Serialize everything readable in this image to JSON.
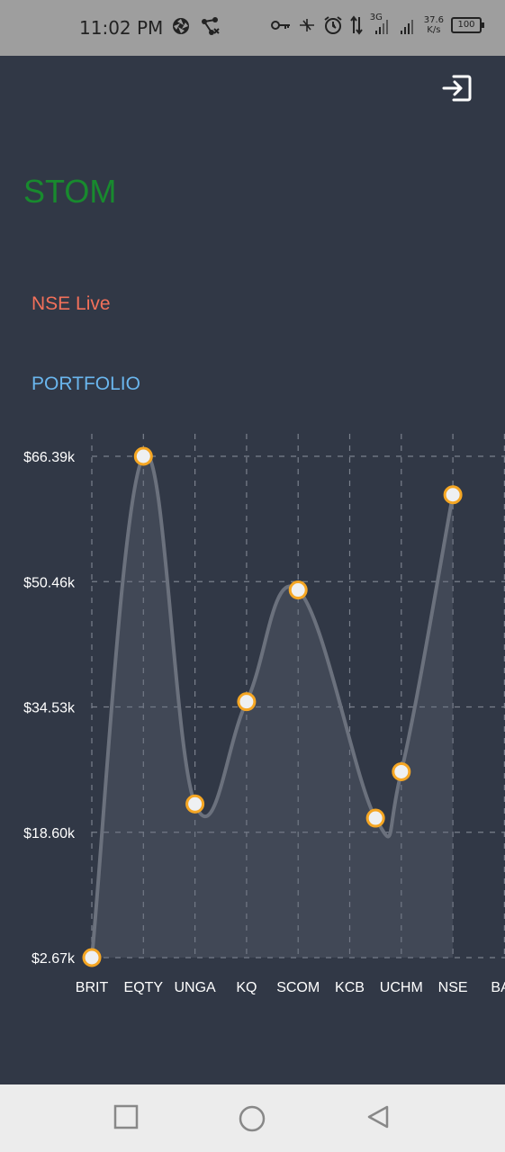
{
  "status_bar": {
    "time": "11:02 PM",
    "network_type": "3G",
    "speed_value": "37.6",
    "speed_unit": "K/s",
    "battery": "100",
    "icons": [
      "aperture-icon",
      "share-icon",
      "key-icon",
      "no-signal-icon",
      "alarm-icon",
      "data-arrows-icon",
      "signal-icon",
      "signal-icon",
      "battery-icon"
    ]
  },
  "header": {
    "brand": "STOM",
    "logout_icon": "logout-icon"
  },
  "menu": {
    "nse_live": "NSE Live",
    "portfolio": "PORTFOLIO"
  },
  "colors": {
    "background": "#313846",
    "brand": "#188a2e",
    "nse_live": "#f2705a",
    "portfolio": "#6ab6ee",
    "line": "#6b717d",
    "point_border": "#f5a623",
    "point_fill": "#eef0f2"
  },
  "chart_data": {
    "type": "area",
    "categories": [
      "BRIT",
      "EQTY",
      "UNGA",
      "KQ",
      "SCOM",
      "KCB",
      "UCHM",
      "NSE",
      "BAT"
    ],
    "values": [
      2.67,
      66.39,
      22.2,
      35.2,
      49.4,
      20.4,
      26.3,
      61.5
    ],
    "point_x": [
      0,
      1,
      2,
      3,
      4,
      5.5,
      6,
      7
    ],
    "y_ticks": [
      "$2.67k",
      "$18.60k",
      "$34.53k",
      "$50.46k",
      "$66.39k"
    ],
    "ylim": [
      2.67,
      66.39
    ],
    "unit": "$k",
    "grid": true,
    "smooth": true
  },
  "navigation": {
    "recent_icon": "square-icon",
    "home_icon": "circle-icon",
    "back_icon": "triangle-back-icon"
  }
}
